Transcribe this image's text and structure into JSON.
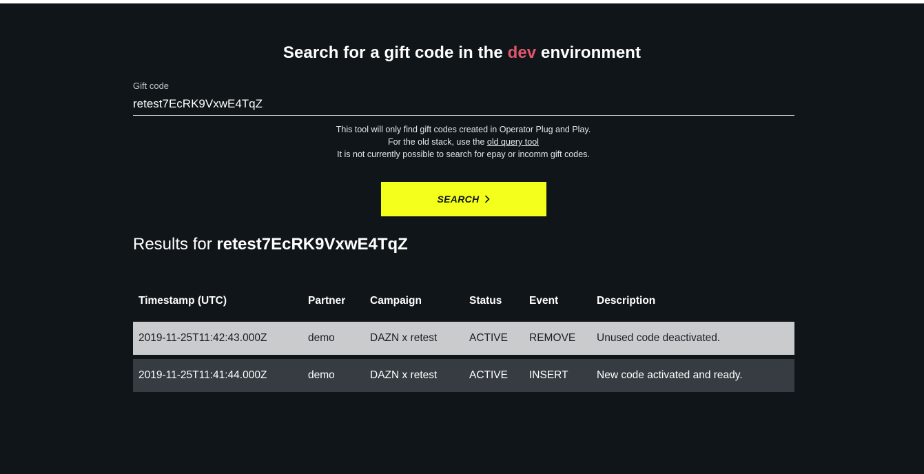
{
  "header": {
    "title_prefix": "Search for a gift code in the ",
    "environment": "dev",
    "title_suffix": " environment",
    "env_color": "#e0576b"
  },
  "search_field": {
    "label": "Gift code",
    "value": "retest7EcRK9VxwE4TqZ"
  },
  "notes": {
    "line1": "This tool will only find gift codes created in Operator Plug and Play.",
    "line2_prefix": "For the old stack, use the ",
    "line2_link": "old query tool",
    "line3": "It is not currently possible to search for epay or incomm gift codes."
  },
  "search_button": {
    "label": "SEARCH",
    "icon": "chevron-right-icon",
    "color": "#f4ff1c"
  },
  "results": {
    "heading_prefix": "Results for ",
    "code": "retest7EcRK9VxwE4TqZ",
    "columns": [
      "Timestamp (UTC)",
      "Partner",
      "Campaign",
      "Status",
      "Event",
      "Description"
    ],
    "rows": [
      [
        "2019-11-25T11:42:43.000Z",
        "demo",
        "DAZN x retest",
        "ACTIVE",
        "REMOVE",
        "Unused code deactivated."
      ],
      [
        "2019-11-25T11:41:44.000Z",
        "demo",
        "DAZN x retest",
        "ACTIVE",
        "INSERT",
        "New code activated and ready."
      ]
    ]
  }
}
